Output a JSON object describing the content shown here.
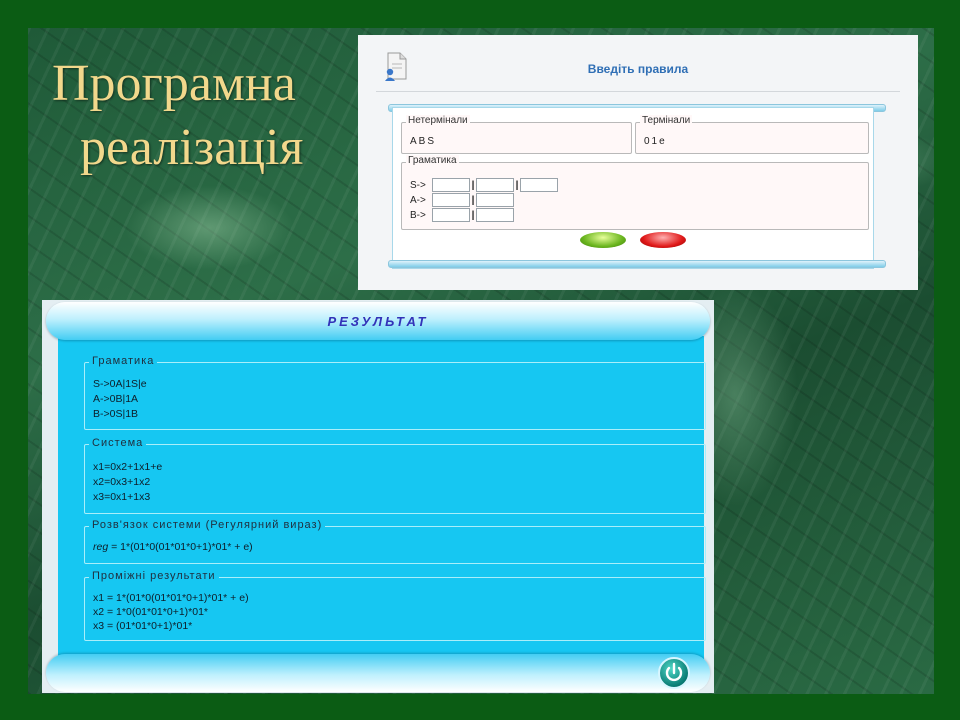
{
  "slide": {
    "title_line1": "Програмна",
    "title_line2": "реалізація"
  },
  "input_dialog": {
    "title": "Введіть правила",
    "icon": "document-user-icon",
    "nonterminals": {
      "label": "Нетермінали",
      "value": "ABS"
    },
    "terminals": {
      "label": "Термінали",
      "value": "01e"
    },
    "grammar": {
      "label": "Граматика",
      "rows": [
        {
          "lhs": "S->",
          "fields": [
            "",
            "",
            ""
          ]
        },
        {
          "lhs": "A->",
          "fields": [
            "",
            ""
          ]
        },
        {
          "lhs": "B->",
          "fields": [
            "",
            ""
          ]
        }
      ],
      "separator": "|"
    },
    "ok_button_icon": "green-ok-button-icon",
    "cancel_button_icon": "red-cancel-button-icon"
  },
  "result_window": {
    "title": "РЕЗУЛЬТАТ",
    "grammar": {
      "label": "Граматика",
      "lines": [
        "S->0A|1S|e",
        "A->0B|1A",
        "B->0S|1B"
      ]
    },
    "system": {
      "label": "Система",
      "lines": [
        "x1=0x2+1x1+e",
        "x2=0x3+1x2",
        "x3=0x1+1x3"
      ]
    },
    "solution": {
      "label": "Розв'язок системи (Регулярний вираз)",
      "prefix": "reg",
      "expr": " = 1*(01*0(01*01*0+1)*01* + e)"
    },
    "intermediate": {
      "label": "Проміжні результати",
      "lines": [
        "x1 = 1*(01*0(01*01*0+1)*01* + e)",
        "x2 = 1*0(01*01*0+1)*01*",
        "x3 = (01*01*0+1)*01*"
      ]
    },
    "power_icon": "power-icon"
  }
}
